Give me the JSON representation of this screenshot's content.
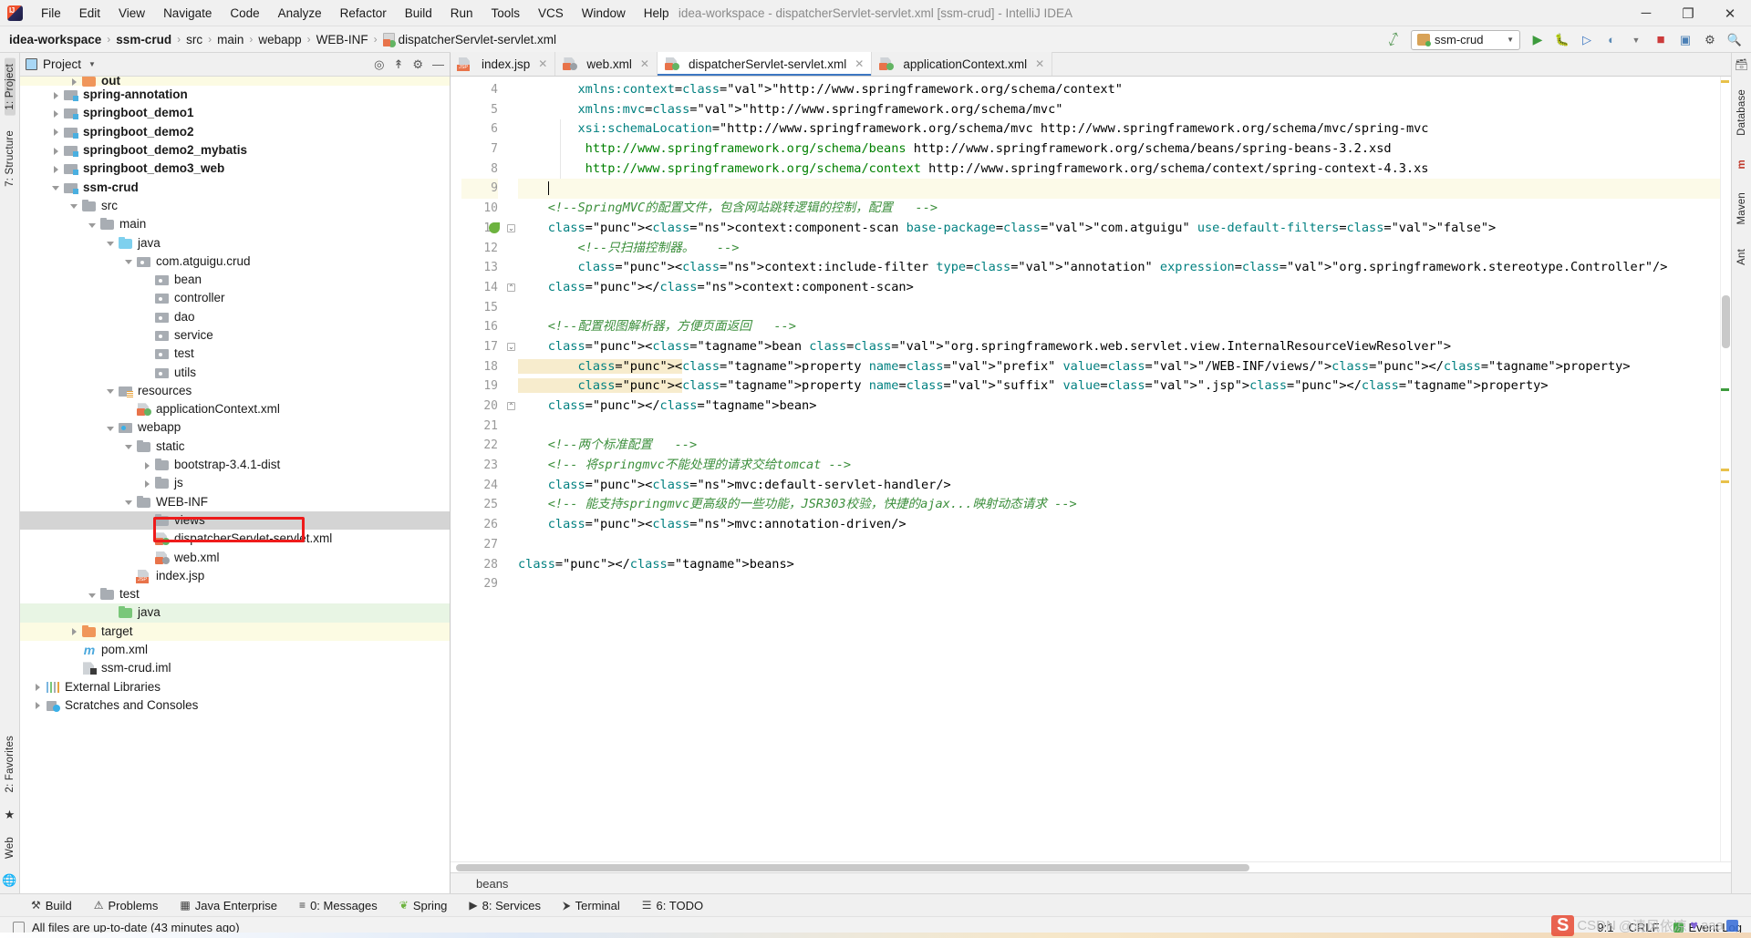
{
  "window": {
    "title": "idea-workspace - dispatcherServlet-servlet.xml [ssm-crud] - IntelliJ IDEA",
    "minimize": "─",
    "maximize": "❐",
    "close": "✕"
  },
  "menubar": [
    {
      "label": "File"
    },
    {
      "label": "Edit"
    },
    {
      "label": "View"
    },
    {
      "label": "Navigate"
    },
    {
      "label": "Code"
    },
    {
      "label": "Analyze"
    },
    {
      "label": "Refactor"
    },
    {
      "label": "Build"
    },
    {
      "label": "Run"
    },
    {
      "label": "Tools"
    },
    {
      "label": "VCS"
    },
    {
      "label": "Window"
    },
    {
      "label": "Help"
    }
  ],
  "breadcrumb": [
    {
      "label": "idea-workspace",
      "bold": true
    },
    {
      "label": "ssm-crud",
      "bold": true
    },
    {
      "label": "src",
      "bold": false
    },
    {
      "label": "main",
      "bold": false
    },
    {
      "label": "webapp",
      "bold": false
    },
    {
      "label": "WEB-INF",
      "bold": false
    },
    {
      "label": "dispatcherServlet-servlet.xml",
      "bold": false,
      "icon": "xml-file-icon"
    }
  ],
  "toolbar": {
    "run_config": "ssm-crud",
    "run_label": "Run",
    "debug_label": "Debug",
    "coverage_label": "Run with Coverage",
    "profile_label": "Profile",
    "stop_label": "Stop",
    "search_label": "Search Everywhere",
    "settings_label": "Settings",
    "project_structure_label": "Project Structure",
    "build_label": "Build Project"
  },
  "project_panel": {
    "title": "Project",
    "tree": [
      {
        "label": "out",
        "depth": 2,
        "arrow": "right",
        "icon": "folder-orange",
        "bold": true,
        "rowstate": "yellow",
        "clipped": true
      },
      {
        "label": "spring-annotation",
        "depth": 1,
        "arrow": "right",
        "icon": "module",
        "bold": true,
        "rowstate": ""
      },
      {
        "label": "springboot_demo1",
        "depth": 1,
        "arrow": "right",
        "icon": "module",
        "bold": true,
        "rowstate": ""
      },
      {
        "label": "springboot_demo2",
        "depth": 1,
        "arrow": "right",
        "icon": "module",
        "bold": true,
        "rowstate": ""
      },
      {
        "label": "springboot_demo2_mybatis",
        "depth": 1,
        "arrow": "right",
        "icon": "module",
        "bold": true,
        "rowstate": ""
      },
      {
        "label": "springboot_demo3_web",
        "depth": 1,
        "arrow": "right",
        "icon": "module",
        "bold": true,
        "rowstate": ""
      },
      {
        "label": "ssm-crud",
        "depth": 1,
        "arrow": "down",
        "icon": "module",
        "bold": true,
        "rowstate": ""
      },
      {
        "label": "src",
        "depth": 2,
        "arrow": "down",
        "icon": "folder",
        "bold": false,
        "rowstate": ""
      },
      {
        "label": "main",
        "depth": 3,
        "arrow": "down",
        "icon": "folder",
        "bold": false,
        "rowstate": ""
      },
      {
        "label": "java",
        "depth": 4,
        "arrow": "down",
        "icon": "folder-blue",
        "bold": false,
        "rowstate": ""
      },
      {
        "label": "com.atguigu.crud",
        "depth": 5,
        "arrow": "down",
        "icon": "pkg",
        "bold": false,
        "rowstate": ""
      },
      {
        "label": "bean",
        "depth": 6,
        "arrow": "none",
        "icon": "pkg",
        "bold": false,
        "rowstate": ""
      },
      {
        "label": "controller",
        "depth": 6,
        "arrow": "none",
        "icon": "pkg",
        "bold": false,
        "rowstate": ""
      },
      {
        "label": "dao",
        "depth": 6,
        "arrow": "none",
        "icon": "pkg",
        "bold": false,
        "rowstate": ""
      },
      {
        "label": "service",
        "depth": 6,
        "arrow": "none",
        "icon": "pkg",
        "bold": false,
        "rowstate": ""
      },
      {
        "label": "test",
        "depth": 6,
        "arrow": "none",
        "icon": "pkg",
        "bold": false,
        "rowstate": ""
      },
      {
        "label": "utils",
        "depth": 6,
        "arrow": "none",
        "icon": "pkg",
        "bold": false,
        "rowstate": ""
      },
      {
        "label": "resources",
        "depth": 4,
        "arrow": "down",
        "icon": "res",
        "bold": false,
        "rowstate": ""
      },
      {
        "label": "applicationContext.xml",
        "depth": 5,
        "arrow": "none",
        "icon": "xml-spring",
        "bold": false,
        "rowstate": ""
      },
      {
        "label": "webapp",
        "depth": 4,
        "arrow": "down",
        "icon": "webroot",
        "bold": false,
        "rowstate": ""
      },
      {
        "label": "static",
        "depth": 5,
        "arrow": "down",
        "icon": "folder",
        "bold": false,
        "rowstate": ""
      },
      {
        "label": "bootstrap-3.4.1-dist",
        "depth": 6,
        "arrow": "right",
        "icon": "folder",
        "bold": false,
        "rowstate": ""
      },
      {
        "label": "js",
        "depth": 6,
        "arrow": "right",
        "icon": "folder",
        "bold": false,
        "rowstate": ""
      },
      {
        "label": "WEB-INF",
        "depth": 5,
        "arrow": "down",
        "icon": "folder",
        "bold": false,
        "rowstate": ""
      },
      {
        "label": "views",
        "depth": 6,
        "arrow": "none",
        "icon": "folder",
        "bold": false,
        "rowstate": "sel"
      },
      {
        "label": "dispatcherServlet-servlet.xml",
        "depth": 6,
        "arrow": "none",
        "icon": "xml-spring",
        "bold": false,
        "rowstate": ""
      },
      {
        "label": "web.xml",
        "depth": 6,
        "arrow": "none",
        "icon": "xml-web",
        "bold": false,
        "rowstate": ""
      },
      {
        "label": "index.jsp",
        "depth": 5,
        "arrow": "none",
        "icon": "jsp",
        "bold": false,
        "rowstate": ""
      },
      {
        "label": "test",
        "depth": 3,
        "arrow": "down",
        "icon": "folder",
        "bold": false,
        "rowstate": ""
      },
      {
        "label": "java",
        "depth": 4,
        "arrow": "none",
        "icon": "folder-green",
        "bold": false,
        "rowstate": "green"
      },
      {
        "label": "target",
        "depth": 2,
        "arrow": "right",
        "icon": "folder-orange",
        "bold": false,
        "rowstate": "yellow"
      },
      {
        "label": "pom.xml",
        "depth": 2,
        "arrow": "none",
        "icon": "maven",
        "bold": false,
        "rowstate": ""
      },
      {
        "label": "ssm-crud.iml",
        "depth": 2,
        "arrow": "none",
        "icon": "iml",
        "bold": false,
        "rowstate": ""
      },
      {
        "label": "External Libraries",
        "depth": 0,
        "arrow": "right",
        "icon": "lib",
        "bold": false,
        "rowstate": ""
      },
      {
        "label": "Scratches and Consoles",
        "depth": 0,
        "arrow": "right",
        "icon": "scratch",
        "bold": false,
        "rowstate": ""
      }
    ]
  },
  "editor": {
    "tabs": [
      {
        "label": "index.jsp",
        "icon": "jsp-file-icon",
        "active": false
      },
      {
        "label": "web.xml",
        "icon": "xml-web-file-icon",
        "active": false
      },
      {
        "label": "dispatcherServlet-servlet.xml",
        "icon": "xml-spring-file-icon",
        "active": true
      },
      {
        "label": "applicationContext.xml",
        "icon": "xml-spring-file-icon",
        "active": false
      }
    ],
    "first_line_number": 4,
    "lines": [
      {
        "n": 4,
        "text": "        xmlns:context=\"http://www.springframework.org/schema/context\""
      },
      {
        "n": 5,
        "text": "        xmlns:mvc=\"http://www.springframework.org/schema/mvc\""
      },
      {
        "n": 6,
        "text": "        xsi:schemaLocation=\"http://www.springframework.org/schema/mvc http://www.springframework.org/schema/mvc/spring-mvc"
      },
      {
        "n": 7,
        "text": "         http://www.springframework.org/schema/beans http://www.springframework.org/schema/beans/spring-beans-3.2.xsd"
      },
      {
        "n": 8,
        "text": "         http://www.springframework.org/schema/context http://www.springframework.org/schema/context/spring-context-4.3.xs"
      },
      {
        "n": 9,
        "text": ""
      },
      {
        "n": 10,
        "text": "    <!--SpringMVC的配置文件，包含网站跳转逻辑的控制，配置   -->"
      },
      {
        "n": 11,
        "text": "    <context:component-scan base-package=\"com.atguigu\" use-default-filters=\"false\">"
      },
      {
        "n": 12,
        "text": "        <!--只扫描控制器。   -->"
      },
      {
        "n": 13,
        "text": "        <context:include-filter type=\"annotation\" expression=\"org.springframework.stereotype.Controller\"/>"
      },
      {
        "n": 14,
        "text": "    </context:component-scan>"
      },
      {
        "n": 15,
        "text": ""
      },
      {
        "n": 16,
        "text": "    <!--配置视图解析器，方便页面返回   -->"
      },
      {
        "n": 17,
        "text": "    <bean class=\"org.springframework.web.servlet.view.InternalResourceViewResolver\">"
      },
      {
        "n": 18,
        "text": "        <property name=\"prefix\" value=\"/WEB-INF/views/\"></property>"
      },
      {
        "n": 19,
        "text": "        <property name=\"suffix\" value=\".jsp\"></property>"
      },
      {
        "n": 20,
        "text": "    </bean>"
      },
      {
        "n": 21,
        "text": ""
      },
      {
        "n": 22,
        "text": "    <!--两个标准配置   -->"
      },
      {
        "n": 23,
        "text": "    <!-- 将springmvc不能处理的请求交给tomcat -->"
      },
      {
        "n": 24,
        "text": "    <mvc:default-servlet-handler/>"
      },
      {
        "n": 25,
        "text": "    <!-- 能支持springmvc更高级的一些功能，JSR303校验，快捷的ajax...映射动态请求 -->"
      },
      {
        "n": 26,
        "text": "    <mvc:annotation-driven/>"
      },
      {
        "n": 27,
        "text": ""
      },
      {
        "n": 28,
        "text": "</beans>"
      },
      {
        "n": 29,
        "text": ""
      }
    ],
    "breadcrumb_bottom": "beans"
  },
  "left_strip": {
    "top": [
      {
        "label": "1: Project"
      },
      {
        "label": "7: Structure"
      }
    ],
    "bottom": [
      {
        "label": "2: Favorites"
      },
      {
        "label": "Web"
      }
    ]
  },
  "right_strip": [
    {
      "label": "Database"
    },
    {
      "label": "m"
    },
    {
      "label": "Maven"
    },
    {
      "label": "Ant"
    }
  ],
  "tool_windows": [
    {
      "label": "Build",
      "icon": "hammer-icon"
    },
    {
      "label": "Problems",
      "icon": "warning-icon"
    },
    {
      "label": "Java Enterprise",
      "icon": "java-ee-icon"
    },
    {
      "label": "0: Messages",
      "icon": "messages-icon"
    },
    {
      "label": "Spring",
      "icon": "spring-leaf-icon"
    },
    {
      "label": "8: Services",
      "icon": "services-icon"
    },
    {
      "label": "Terminal",
      "icon": "terminal-icon"
    },
    {
      "label": "6: TODO",
      "icon": "todo-icon"
    }
  ],
  "statusbar": {
    "message": "All files are up-to-date (43 minutes ago)",
    "caret_position": "9:1",
    "line_separator": "CRLF",
    "event_log": "Event Log"
  },
  "watermark": {
    "csdn": "CSDN",
    "author": "@清风依凉",
    "suffix": "aaa"
  }
}
